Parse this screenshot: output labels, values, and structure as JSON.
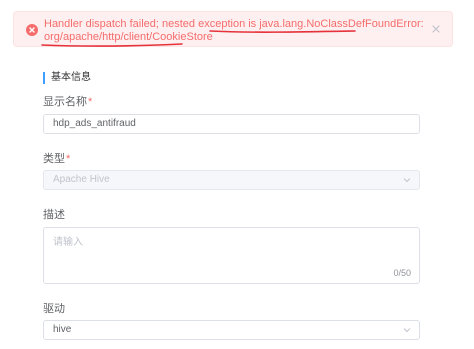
{
  "alert": {
    "type": "error",
    "icon": "error-circle-icon",
    "message_line1": "Handler dispatch failed; nested exception is java.lang.NoClassDefFoundError:",
    "message_line2": "org/apache/http/client/CookieStore",
    "close_icon": "close-icon",
    "color": "#f56c6c"
  },
  "section": {
    "title": "基本信息",
    "accent": "#409eff"
  },
  "form": {
    "display_name": {
      "label": "显示名称",
      "required": "*",
      "value": "hdp_ads_antifraud"
    },
    "type": {
      "label": "类型",
      "required": "*",
      "value": "Apache Hive",
      "disabled": true,
      "arrow_icon": "chevron-down-icon"
    },
    "description": {
      "label": "描述",
      "placeholder": "请输入",
      "counter": "0/50"
    },
    "driver": {
      "label": "驱动",
      "value": "hive",
      "arrow_icon": "chevron-down-icon"
    }
  }
}
